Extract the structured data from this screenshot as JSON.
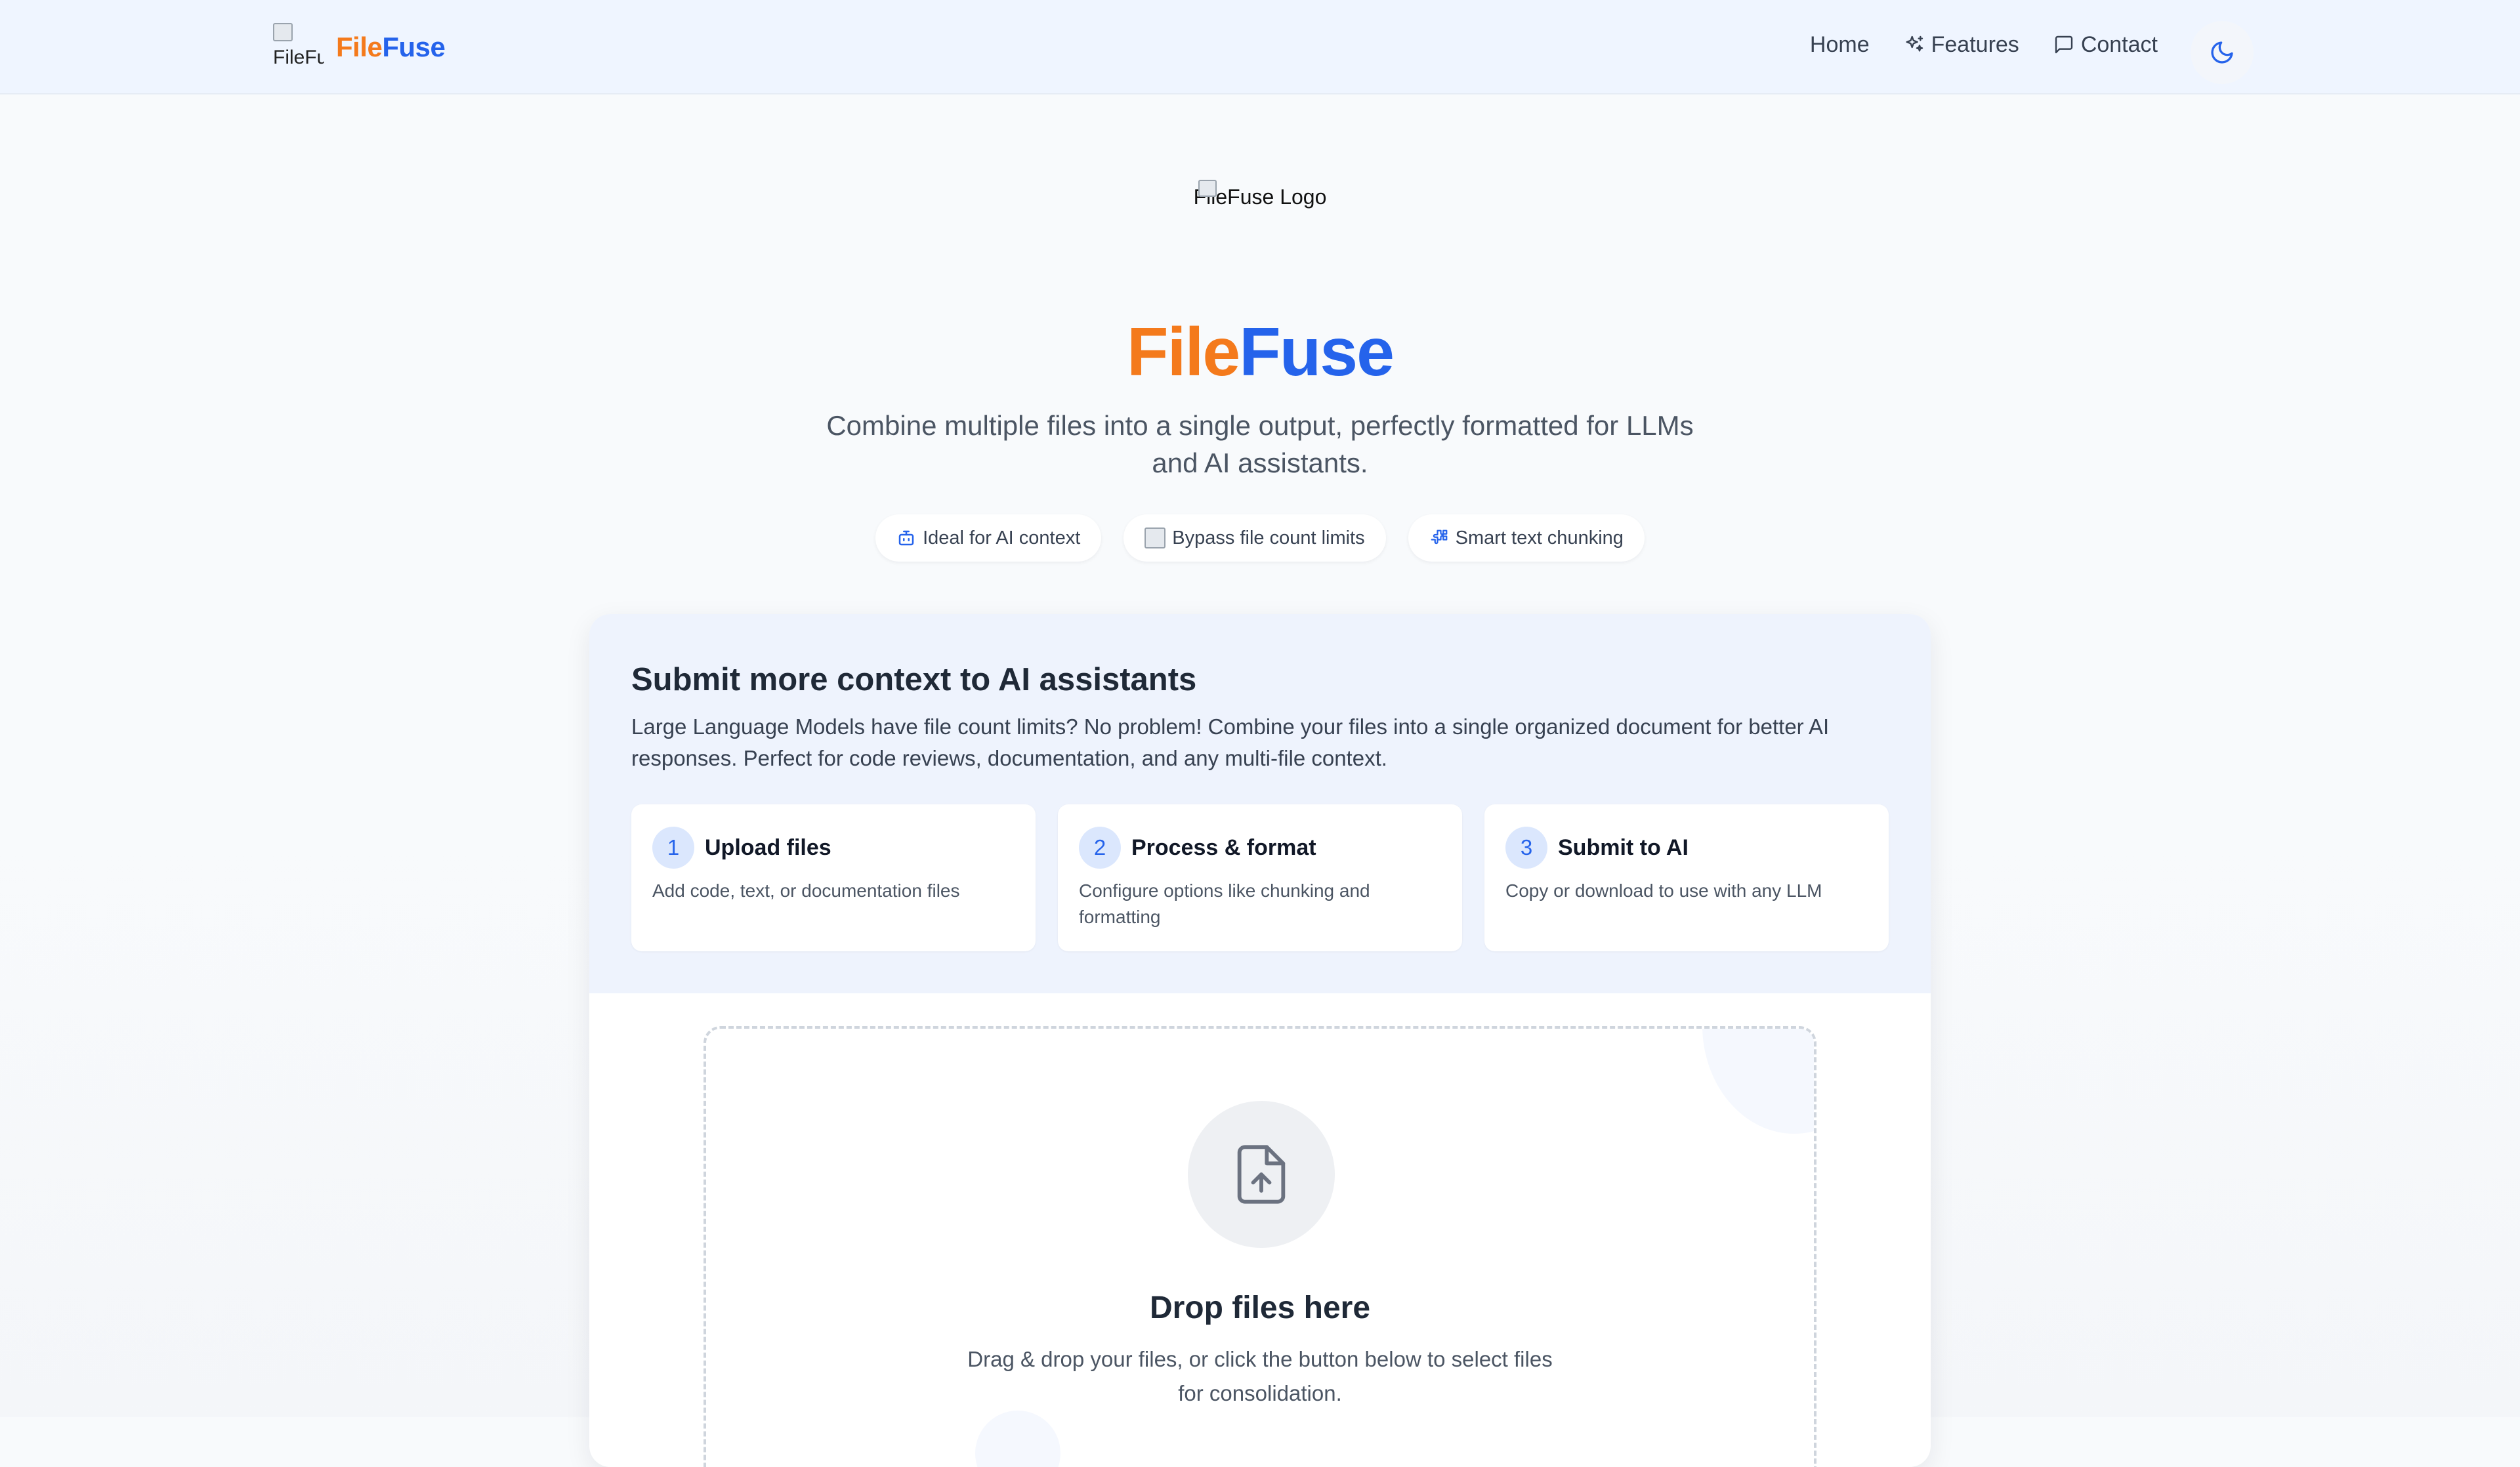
{
  "header": {
    "logo_alt": "FileFuse",
    "brand_part1": "File",
    "brand_part2": "Fuse",
    "nav": [
      {
        "label": "Home",
        "icon": null
      },
      {
        "label": "Features",
        "icon": "sparkles-icon"
      },
      {
        "label": "Contact",
        "icon": "message-square-icon"
      }
    ],
    "theme_toggle_icon": "moon-icon"
  },
  "hero": {
    "logo_alt": "FileFuse Logo",
    "title_part1": "File",
    "title_part2": "Fuse",
    "subtitle": "Combine multiple files into a single output, perfectly formatted for LLMs and AI assistants.",
    "chips": [
      {
        "label": "Ideal for AI context",
        "icon": "bot-icon"
      },
      {
        "label": "Bypass file count limits",
        "icon": "broken-image-icon"
      },
      {
        "label": "Smart text chunking",
        "icon": "puzzle-icon"
      }
    ]
  },
  "info": {
    "title": "Submit more context to AI assistants",
    "description": "Large Language Models have file count limits? No problem! Combine your files into a single organized document for better AI responses. Perfect for code reviews, documentation, and any multi-file context.",
    "steps": [
      {
        "number": "1",
        "title": "Upload files",
        "description": "Add code, text, or documentation files"
      },
      {
        "number": "2",
        "title": "Process & format",
        "description": "Configure options like chunking and formatting"
      },
      {
        "number": "3",
        "title": "Submit to AI",
        "description": "Copy or download to use with any LLM"
      }
    ]
  },
  "dropzone": {
    "icon": "file-upload-icon",
    "title": "Drop files here",
    "subtitle": "Drag & drop your files, or click the button below to select files for consolidation."
  },
  "colors": {
    "brand_orange": "#f47a1c",
    "brand_blue": "#2563eb",
    "header_bg": "#eff5ff",
    "info_bg": "#eef3fd"
  }
}
